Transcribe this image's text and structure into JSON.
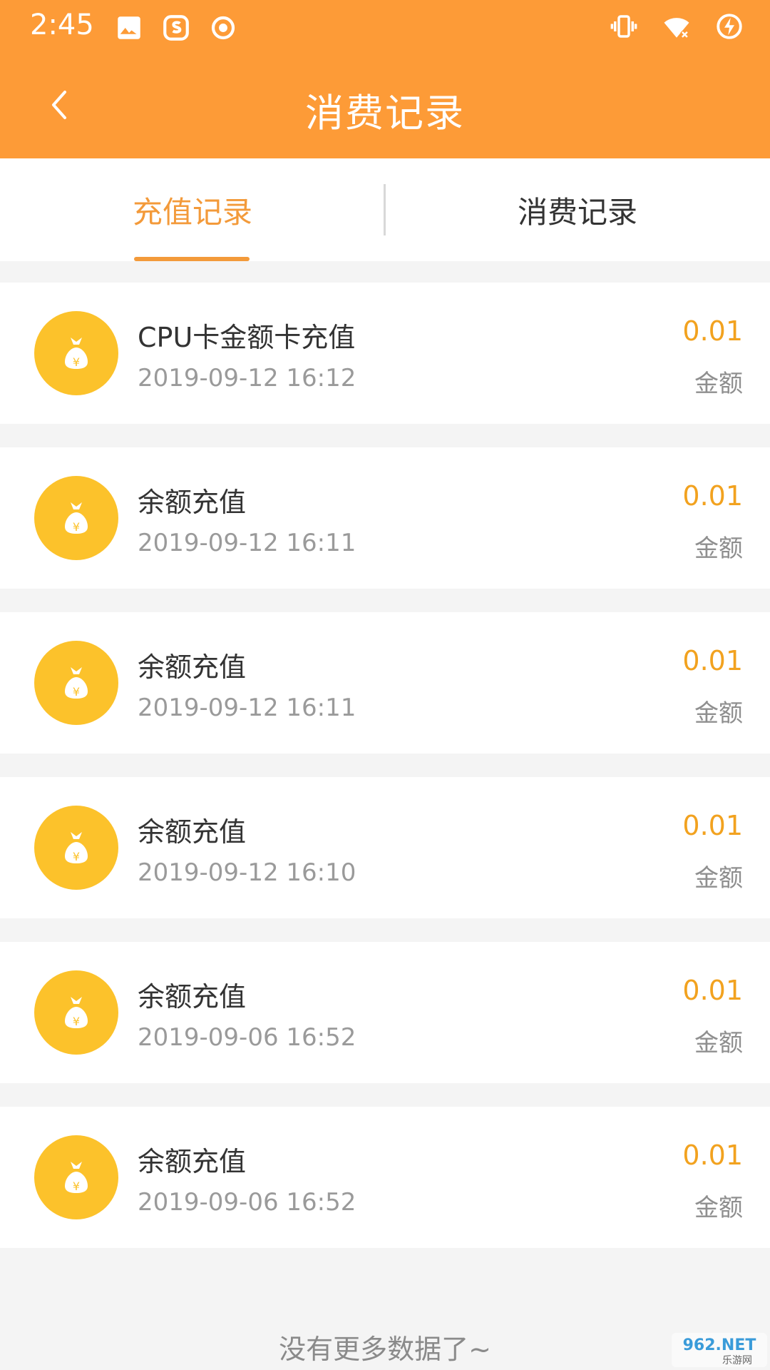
{
  "status_bar": {
    "time": "2:45",
    "left_icons": [
      "image-icon",
      "sogou-icon",
      "record-icon"
    ],
    "right_icons": [
      "vibrate-icon",
      "wifi-off-icon",
      "battery-charging-icon"
    ]
  },
  "header": {
    "title": "消费记录",
    "back_icon": "chevron-left-icon",
    "color": "#fd9b37"
  },
  "tabs": [
    {
      "label": "充值记录",
      "active": true
    },
    {
      "label": "消费记录",
      "active": false
    }
  ],
  "accent_color": "#f39a3a",
  "records": [
    {
      "title": "CPU卡金额卡充值",
      "date": "2019-09-12 16:12",
      "amount": "0.01",
      "amount_label": "金额"
    },
    {
      "title": "余额充值",
      "date": "2019-09-12 16:11",
      "amount": "0.01",
      "amount_label": "金额"
    },
    {
      "title": "余额充值",
      "date": "2019-09-12 16:11",
      "amount": "0.01",
      "amount_label": "金额"
    },
    {
      "title": "余额充值",
      "date": "2019-09-12 16:10",
      "amount": "0.01",
      "amount_label": "金额"
    },
    {
      "title": "余额充值",
      "date": "2019-09-06 16:52",
      "amount": "0.01",
      "amount_label": "金额"
    },
    {
      "title": "余额充值",
      "date": "2019-09-06 16:52",
      "amount": "0.01",
      "amount_label": "金额"
    }
  ],
  "footer": {
    "no_more": "没有更多数据了~"
  },
  "watermark": {
    "text": "962.NET",
    "subtext": "乐游网"
  }
}
